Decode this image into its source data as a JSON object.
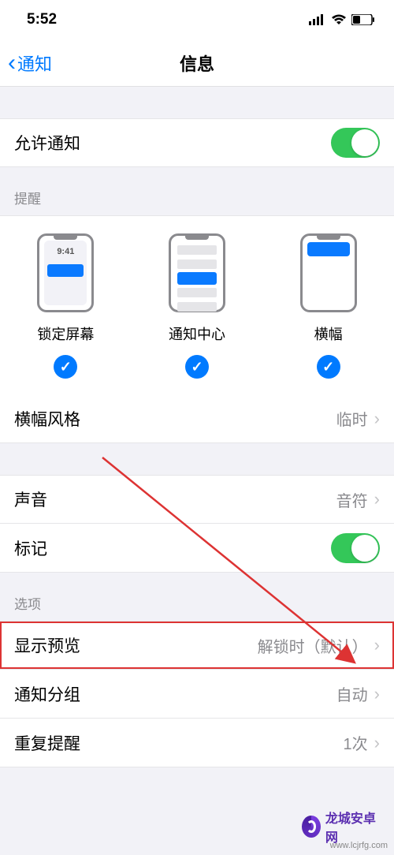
{
  "status": {
    "time": "5:52"
  },
  "nav": {
    "back": "通知",
    "title": "信息"
  },
  "rows": {
    "allow": "允许通知",
    "banner_style": {
      "label": "横幅风格",
      "value": "临时"
    },
    "sound": {
      "label": "声音",
      "value": "音符"
    },
    "badges": "标记",
    "show_preview": {
      "label": "显示预览",
      "value": "解锁时（默认）"
    },
    "grouping": {
      "label": "通知分组",
      "value": "自动"
    },
    "repeat": {
      "label": "重复提醒",
      "value": "1次"
    }
  },
  "headers": {
    "alerts": "提醒",
    "options": "选项"
  },
  "alerts": {
    "lock": "锁定屏幕",
    "center": "通知中心",
    "banner": "横幅",
    "preview_time": "9:41"
  },
  "watermark": {
    "name": "龙城安卓网",
    "url": "www.lcjrfg.com"
  }
}
